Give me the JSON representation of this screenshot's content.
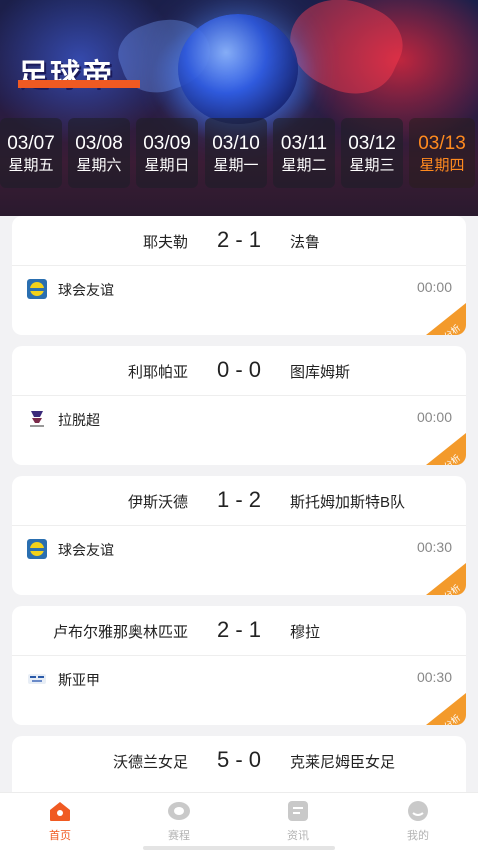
{
  "app": {
    "logo_text": "足球帝"
  },
  "dates": [
    {
      "date": "03/07",
      "weekday": "星期五",
      "active": false
    },
    {
      "date": "03/08",
      "weekday": "星期六",
      "active": false
    },
    {
      "date": "03/09",
      "weekday": "星期日",
      "active": false
    },
    {
      "date": "03/10",
      "weekday": "星期一",
      "active": false
    },
    {
      "date": "03/11",
      "weekday": "星期二",
      "active": false
    },
    {
      "date": "03/12",
      "weekday": "星期三",
      "active": false
    },
    {
      "date": "03/13",
      "weekday": "星期四",
      "active": true
    }
  ],
  "matches": [
    {
      "home": "耶夫勒",
      "score": "2 - 1",
      "away": "法鲁",
      "league": "球会友谊",
      "league_icon": "friendly-badge-icon",
      "time": "00:00",
      "analysis": "分析"
    },
    {
      "home": "利耶帕亚",
      "score": "0 - 0",
      "away": "图库姆斯",
      "league": "拉脱超",
      "league_icon": "latvian-league-icon",
      "time": "00:00",
      "analysis": "分析"
    },
    {
      "home": "伊斯沃德",
      "score": "1 - 2",
      "away": "斯托姆加斯特B队",
      "league": "球会友谊",
      "league_icon": "friendly-badge-icon",
      "time": "00:30",
      "analysis": "分析"
    },
    {
      "home": "卢布尔雅那奥林匹亚",
      "score": "2 - 1",
      "away": "穆拉",
      "league": "斯亚甲",
      "league_icon": "slovenian-league-icon",
      "time": "00:30",
      "analysis": "分析"
    },
    {
      "home": "沃德兰女足",
      "score": "5 - 0",
      "away": "克莱尼姆臣女足"
    }
  ],
  "tabbar": [
    {
      "label": "首页",
      "icon": "home-icon",
      "active": true
    },
    {
      "label": "赛程",
      "icon": "schedule-icon",
      "active": false
    },
    {
      "label": "资讯",
      "icon": "news-icon",
      "active": false
    },
    {
      "label": "我的",
      "icon": "profile-icon",
      "active": false
    }
  ],
  "colors": {
    "accent": "#f05a22",
    "analysis_tag": "#f39a2b",
    "active_date": "#ff8a1f"
  }
}
